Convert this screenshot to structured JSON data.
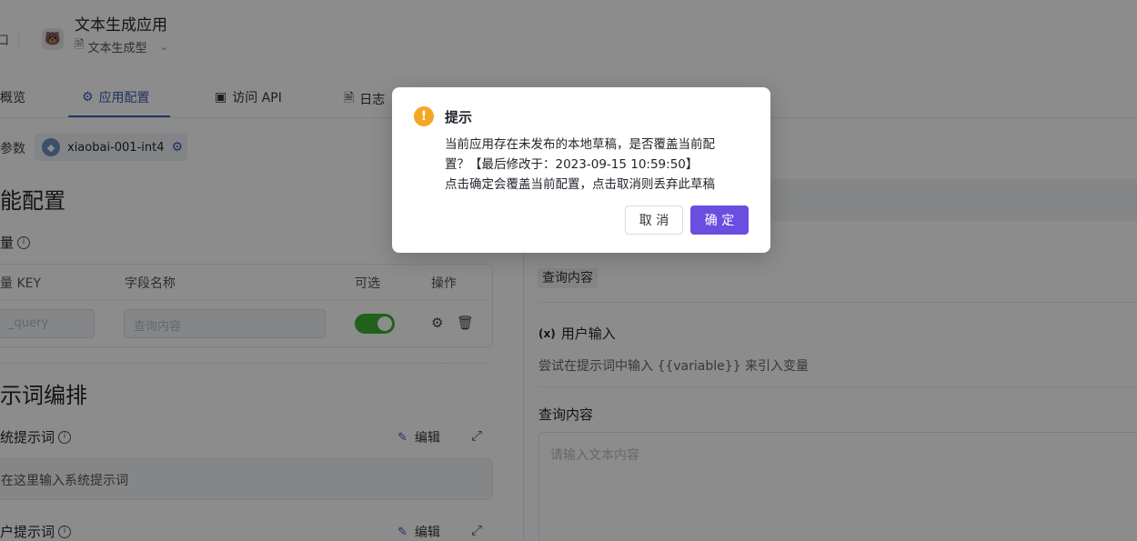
{
  "header": {
    "left_cut_text": "口",
    "app_title": "文本生成应用",
    "app_type": "文本生成型",
    "app_icon": "bear-face-icon"
  },
  "tabs": [
    {
      "label": "概览",
      "icon": "none"
    },
    {
      "label": "应用配置",
      "icon": "gear-icon",
      "active": true
    },
    {
      "label": "访问 API",
      "icon": "terminal-icon"
    },
    {
      "label": "日志",
      "icon": "document-icon"
    }
  ],
  "model": {
    "label": "参数",
    "name": "xiaobai-001-int4"
  },
  "left": {
    "config_title": "能配置",
    "variables_label": "量",
    "table_headers": [
      "量 KEY",
      "字段名称",
      "可选",
      "操作"
    ],
    "row": {
      "key_placeholder": "_query",
      "name_placeholder": "查询内容",
      "optional_on": true
    },
    "prompt_section_title": "示词编排",
    "system_prompt_label": "统提示词",
    "edit_label": "编辑",
    "system_prompt_placeholder": "在这里输入系统提示词",
    "user_prompt_label": "户提示词"
  },
  "right": {
    "chip": "查询内容",
    "user_input_title": "用户输入",
    "hint": "尝试在提示词中输入 {{variable}} 来引入变量",
    "query_label": "查询内容",
    "query_placeholder": "请输入文本内容"
  },
  "modal": {
    "title": "提示",
    "line1": "当前应用存在未发布的本地草稿，是否覆盖当前配",
    "line2": "置？【最后修改于：2023-09-15 10:59:50】",
    "line3": "点击确定会覆盖当前配置，点击取消则丢弃此草稿",
    "cancel": "取 消",
    "ok": "确 定"
  },
  "colors": {
    "accent": "#3b5bb7",
    "primary_button": "#6a4ee0",
    "warning": "#f5a623",
    "toggle_on": "#3fb12f"
  }
}
